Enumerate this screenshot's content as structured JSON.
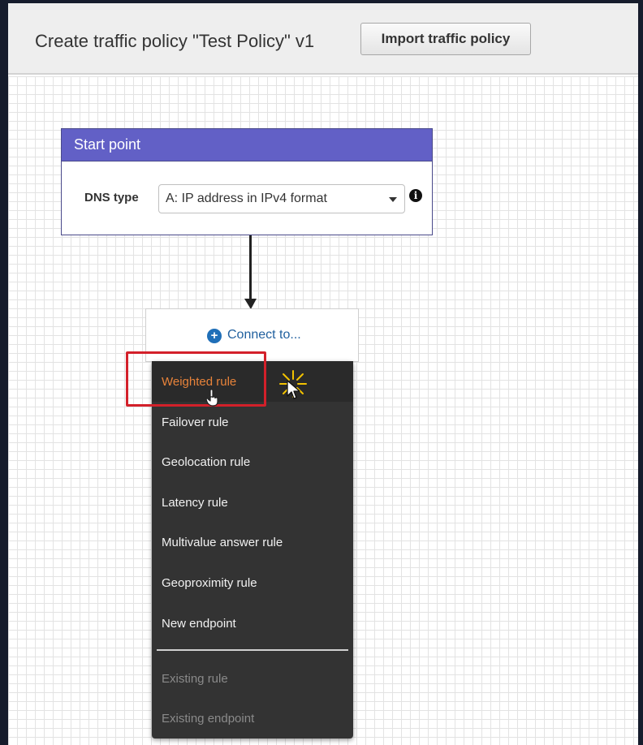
{
  "header": {
    "title": "Create traffic policy \"Test Policy\" v1",
    "import_button": "Import traffic policy"
  },
  "start_point": {
    "title": "Start point",
    "dns_label": "DNS type",
    "dns_value": "A: IP address in IPv4 format",
    "info_icon": "i"
  },
  "connect": {
    "icon": "+",
    "label": "Connect to..."
  },
  "menu": {
    "items": [
      {
        "label": "Weighted rule"
      },
      {
        "label": "Failover rule"
      },
      {
        "label": "Geolocation rule"
      },
      {
        "label": "Latency rule"
      },
      {
        "label": "Multivalue answer rule"
      },
      {
        "label": "Geoproximity rule"
      },
      {
        "label": "New endpoint"
      }
    ],
    "disabled_items": [
      {
        "label": "Existing rule"
      },
      {
        "label": "Existing endpoint"
      }
    ]
  },
  "icons": {
    "info": "info-icon",
    "plus": "plus-circle-icon",
    "caret": "caret-down-icon",
    "cursor": "hand-pointer-icon"
  },
  "colors": {
    "start_header": "#6260c6",
    "link": "#1f5f9e",
    "menu_bg": "#333333",
    "hover_text": "#e8833a",
    "highlight": "#d3202a"
  }
}
